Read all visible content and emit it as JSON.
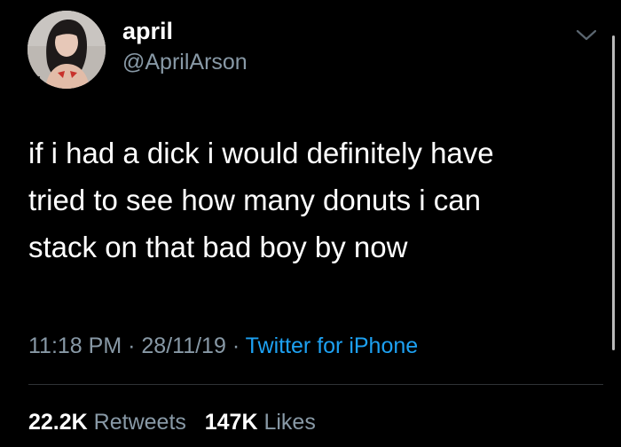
{
  "user": {
    "display_name": "april",
    "handle": "@AprilArson"
  },
  "tweet": {
    "text_lines": [
      "if i had a dick i would definitely have",
      "tried to see how many donuts i can",
      "stack on that bad boy by now"
    ],
    "time": "11:18 PM",
    "date": "28/11/19",
    "separator": "·",
    "source": "Twitter for iPhone"
  },
  "stats": {
    "retweets_count": "22.2K",
    "retweets_label": "Retweets",
    "likes_count": "147K",
    "likes_label": "Likes"
  },
  "icons": {
    "menu": "chevron-down-icon",
    "avatar": "profile-photo"
  },
  "colors": {
    "background": "#000000",
    "primary_text": "#ffffff",
    "secondary_text": "#8899a6",
    "link": "#1da1f2",
    "divider": "#2f3336"
  }
}
